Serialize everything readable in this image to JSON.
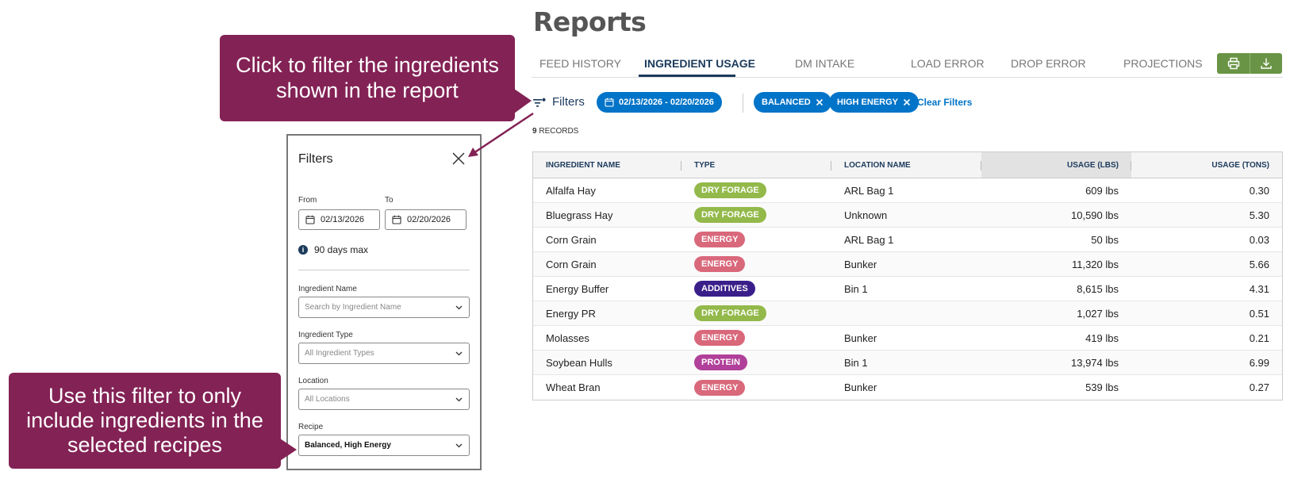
{
  "page": {
    "title": "Reports"
  },
  "tabs": [
    {
      "label": "FEED HISTORY"
    },
    {
      "label": "INGREDIENT USAGE"
    },
    {
      "label": "DM INTAKE"
    },
    {
      "label": "LOAD ERROR"
    },
    {
      "label": "DROP ERROR"
    },
    {
      "label": "PROJECTIONS"
    }
  ],
  "active_tab": "INGREDIENT USAGE",
  "export": {
    "print_icon": "printer-icon",
    "download_icon": "download-icon",
    "color": "#6a9445"
  },
  "filters_bar": {
    "filters_label": "Filters",
    "date_chip": "02/13/2026 - 02/20/2026",
    "recipe_chips": [
      "BALANCED",
      "HIGH ENERGY"
    ],
    "clear_label": "Clear Filters",
    "chip_color": "#0074c8"
  },
  "records": {
    "count": "9",
    "label": "RECORDS"
  },
  "table": {
    "headers": [
      "INGREDIENT NAME",
      "TYPE",
      "LOCATION NAME",
      "USAGE (LBS)",
      "USAGE (TONS)"
    ],
    "rows": [
      {
        "name": "Alfalfa Hay",
        "type": "DRY FORAGE",
        "location": "ARL Bag 1",
        "lbs": "609 lbs",
        "tons": "0.30"
      },
      {
        "name": "Bluegrass Hay",
        "type": "DRY FORAGE",
        "location": "Unknown",
        "lbs": "10,590 lbs",
        "tons": "5.30"
      },
      {
        "name": "Corn Grain",
        "type": "ENERGY",
        "location": "ARL Bag 1",
        "lbs": "50 lbs",
        "tons": "0.03"
      },
      {
        "name": "Corn Grain",
        "type": "ENERGY",
        "location": "Bunker",
        "lbs": "11,320 lbs",
        "tons": "5.66"
      },
      {
        "name": "Energy Buffer",
        "type": "ADDITIVES",
        "location": "Bin 1",
        "lbs": "8,615 lbs",
        "tons": "4.31"
      },
      {
        "name": "Energy PR",
        "type": "DRY FORAGE",
        "location": "",
        "lbs": "1,027 lbs",
        "tons": "0.51"
      },
      {
        "name": "Molasses",
        "type": "ENERGY",
        "location": "Bunker",
        "lbs": "419 lbs",
        "tons": "0.21"
      },
      {
        "name": "Soybean Hulls",
        "type": "PROTEIN",
        "location": "Bin 1",
        "lbs": "13,974 lbs",
        "tons": "6.99"
      },
      {
        "name": "Wheat Bran",
        "type": "ENERGY",
        "location": "Bunker",
        "lbs": "539 lbs",
        "tons": "0.27"
      }
    ],
    "type_colors": {
      "DRY FORAGE": "#93b94a",
      "ENERGY": "#d9687b",
      "ADDITIVES": "#3a1f8a",
      "PROTEIN": "#b04099"
    }
  },
  "panel": {
    "title": "Filters",
    "from_label": "From",
    "to_label": "To",
    "from_value": "02/13/2026",
    "to_value": "02/20/2026",
    "hint": "90 days max",
    "ingredient_name_label": "Ingredient Name",
    "ingredient_name_placeholder": "Search by Ingredient Name",
    "ingredient_type_label": "Ingredient Type",
    "ingredient_type_value": "All Ingredient Types",
    "location_label": "Location",
    "location_value": "All Locations",
    "recipe_label": "Recipe",
    "recipe_value": "Balanced, High Energy"
  },
  "callouts": {
    "top": "Click to filter the ingredients shown in the report",
    "bottom": "Use this filter to only include ingredients in the selected recipes",
    "color": "#832255"
  }
}
